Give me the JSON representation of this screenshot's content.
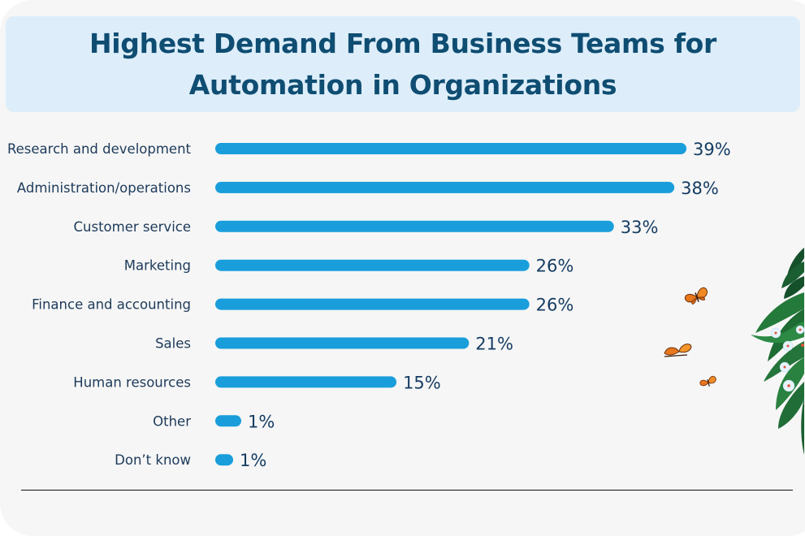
{
  "chart_data": {
    "type": "bar",
    "orientation": "horizontal",
    "title": "Highest Demand From Business Teams for Automation in Organizations",
    "categories": [
      "Research and development",
      "Administration/operations",
      "Customer service",
      "Marketing",
      "Finance and accounting",
      "Sales",
      "Human resources",
      "Other",
      "Don’t know"
    ],
    "values": [
      39,
      38,
      33,
      26,
      26,
      21,
      15,
      1,
      1
    ],
    "value_labels": [
      "39%",
      "38%",
      "33%",
      "26%",
      "26%",
      "21%",
      "15%",
      "1%",
      "1%"
    ],
    "xlabel": "",
    "ylabel": "",
    "xlim": [
      0,
      39
    ],
    "grid": false,
    "legend": "none",
    "unit": "%"
  },
  "colors": {
    "bar": "#199edb",
    "title_text": "#0f4d72",
    "title_background": "#ddeefa",
    "category_text": "#1d3a5a",
    "value_text": "#163d63",
    "background": "#f6f6f6"
  },
  "decorations": {
    "butterflies": [
      "butterfly-icon",
      "butterfly-icon",
      "butterfly-icon"
    ],
    "plant": "leafy-plant-with-flowers"
  }
}
